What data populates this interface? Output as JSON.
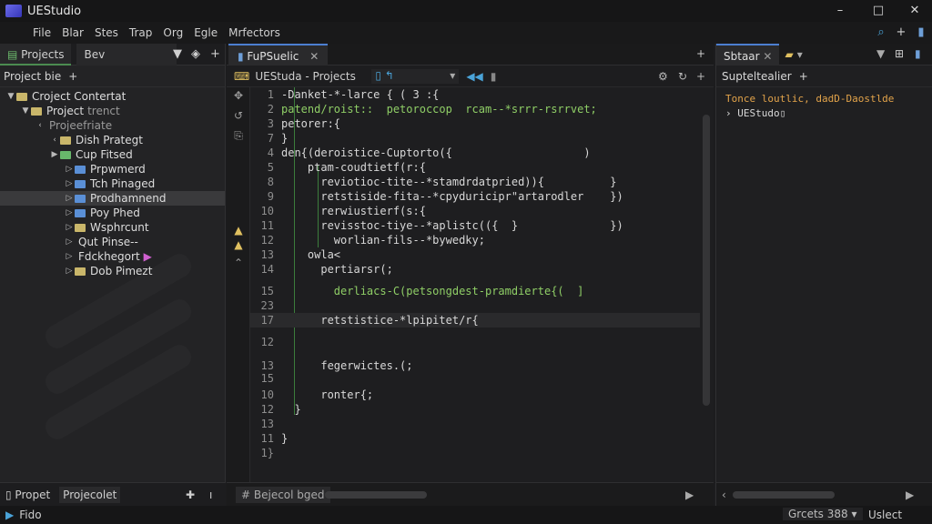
{
  "window": {
    "title": "UEStudio",
    "controls": [
      "–",
      "□",
      "✕"
    ]
  },
  "menu": {
    "items": [
      "File",
      "Blar",
      "Stes",
      "Trap",
      "Org",
      "Egle",
      "Mrfectors"
    ]
  },
  "toolbar_right": {
    "icons": [
      "search-icon",
      "plus-icon",
      "doc-icon"
    ]
  },
  "left_panel": {
    "tabs": [
      "Projects",
      "Bev"
    ],
    "header": "Project bie",
    "tree": [
      {
        "label": "Croject Contertat",
        "level": 0,
        "twisty": "▼",
        "icon": "yellow"
      },
      {
        "label": "Project",
        "suffix": "trenct",
        "level": 1,
        "twisty": "▼",
        "icon": "yellow"
      },
      {
        "label": "Projeefriate",
        "level": 2,
        "twisty": "‹",
        "icon": "none",
        "dim": true
      },
      {
        "label": "Dish Prategt",
        "level": 3,
        "twisty": "‹",
        "icon": "yellow"
      },
      {
        "label": "Cup Fitsed",
        "level": 3,
        "twisty": "▶",
        "icon": "green"
      },
      {
        "label": "Prpwmerd",
        "level": 4,
        "twisty": "▷",
        "icon": "blue"
      },
      {
        "label": "Tch Pinaged",
        "level": 4,
        "twisty": "▷",
        "icon": "blue"
      },
      {
        "label": "Prodhamnend",
        "level": 4,
        "twisty": "▷",
        "icon": "blue",
        "selected": true
      },
      {
        "label": "Poy Phed",
        "level": 4,
        "twisty": "▷",
        "icon": "blue"
      },
      {
        "label": "Wsphrcunt",
        "level": 4,
        "twisty": "▷",
        "icon": "yellow"
      },
      {
        "label": "Qut Pinse--",
        "level": 4,
        "twisty": "▷",
        "icon": "none"
      },
      {
        "label": "Fdckhegort",
        "level": 4,
        "twisty": "▷",
        "icon": "none",
        "marker": "▶"
      },
      {
        "label": "Dob Pimezt",
        "level": 4,
        "twisty": "▷",
        "icon": "yellow"
      }
    ],
    "footer_tabs": [
      "Propet",
      "Projecolet"
    ]
  },
  "editor": {
    "tab": "FuPSuelic",
    "breadcrumb": "UEStuda - Projects",
    "lines": [
      {
        "n": "1",
        "code": "-Danket-*-larce { ( 3 :{",
        "color": "#d8d8d8"
      },
      {
        "n": "2",
        "code": "patend/roist::  petoroccop  rcam--*srrr-rsrrvet;",
        "color": "#8fce66"
      },
      {
        "n": "3",
        "code": "petorer:{",
        "color": "#d8d8d8"
      },
      {
        "n": "7",
        "code": "}",
        "color": "#d8d8d8"
      },
      {
        "n": "4",
        "code": "den{(deroistice-Cuptorto({                    )",
        "color": "#d8d8d8"
      },
      {
        "n": "5",
        "code": "    ptam-coudtietf(r:{",
        "color": "#d8d8d8"
      },
      {
        "n": "8",
        "code": "      reviotioc-tite--*stamdrdatpried)){          }",
        "color": "#d8d8d8"
      },
      {
        "n": "9",
        "code": "      retstiside-fita--*cpyduricipr\"artarodler    })",
        "color": "#d8d8d8"
      },
      {
        "n": "10",
        "code": "      rerwiustierf(s:{",
        "color": "#d8d8d8"
      },
      {
        "n": "11",
        "code": "      revisstoc-tiye--*aplistc(({  }              })",
        "color": "#d8d8d8"
      },
      {
        "n": "12",
        "code": "        worlian-fils--*bywedky;",
        "color": "#d8d8d8"
      },
      {
        "n": "13",
        "code": "    owla<",
        "color": "#d8d8d8"
      },
      {
        "n": "14",
        "code": "      pertiarsr(;",
        "color": "#d8d8d8"
      },
      {
        "n": "15",
        "code": "        derliacs-C(petsongdest-pramdierte{(  ]",
        "color": "#8fce66"
      },
      {
        "n": "23",
        "code": "",
        "color": "#d8d8d8"
      },
      {
        "n": "17",
        "code": "      retstistice-*lpipitet/r{",
        "color": "#d8d8d8"
      },
      {
        "n": "12",
        "code": "",
        "color": "#d8d8d8"
      },
      {
        "n": "13",
        "code": "      fegerwictes.(;",
        "color": "#d8d8d8"
      },
      {
        "n": "15",
        "code": "",
        "color": "#d8d8d8"
      },
      {
        "n": "10",
        "code": "      ronter{;",
        "color": "#d8d8d8"
      },
      {
        "n": "12",
        "code": "  }",
        "color": "#d8d8d8"
      },
      {
        "n": "13",
        "code": "",
        "color": "#d8d8d8"
      },
      {
        "n": "11",
        "code": "}",
        "color": "#d8d8d8"
      },
      {
        "n": "1}",
        "code": "",
        "color": "#d8d8d8"
      }
    ],
    "footer_tab": "Bejecol bged"
  },
  "right_panel": {
    "tabs": [
      "Sbtaar"
    ],
    "subheader": "Supteltealier",
    "lines": [
      {
        "text": "Tonce loutlic, dadD-Daostlde",
        "color": "#e2a34a"
      },
      {
        "text": "› UEStudo▯",
        "color": "#d8d8d8"
      }
    ]
  },
  "status": {
    "left": "Fido",
    "middle": "Grcets 388",
    "right": "Uslect"
  },
  "colors": {
    "accent_blue": "#4c7fd1",
    "accent_green": "#4b8b50",
    "code_green": "#8fce66",
    "terminal_orange": "#e2a34a"
  }
}
